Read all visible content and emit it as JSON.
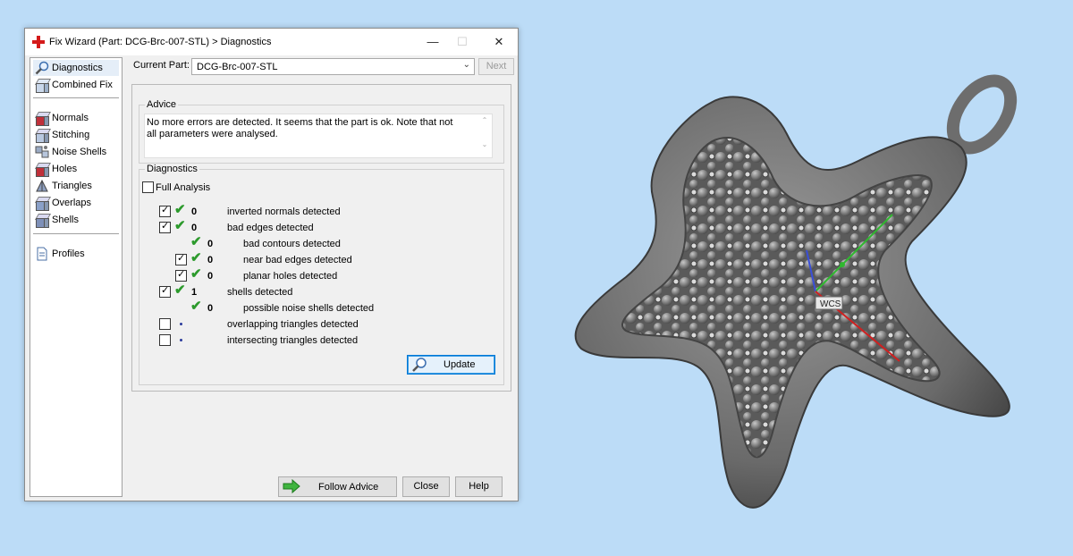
{
  "window": {
    "title": "Fix Wizard (Part: DCG-Brc-007-STL) > Diagnostics",
    "controls": {
      "minimize": "—",
      "maximize": "☐",
      "close": "✕"
    }
  },
  "nav": {
    "items": [
      {
        "label": "Diagnostics",
        "icon": "magnifier-icon",
        "selected": true
      },
      {
        "label": "Combined Fix",
        "icon": "cube-icon"
      },
      {
        "label": "Normals",
        "icon": "cube-red-icon"
      },
      {
        "label": "Stitching",
        "icon": "cube-stitch-icon"
      },
      {
        "label": "Noise Shells",
        "icon": "noise-shells-icon"
      },
      {
        "label": "Holes",
        "icon": "cube-holes-icon"
      },
      {
        "label": "Triangles",
        "icon": "triangles-icon"
      },
      {
        "label": "Overlaps",
        "icon": "cube-overlaps-icon"
      },
      {
        "label": "Shells",
        "icon": "cube-shells-icon"
      },
      {
        "label": "Profiles",
        "icon": "document-icon"
      }
    ]
  },
  "current_part": {
    "label": "Current Part:",
    "value": "DCG-Brc-007-STL"
  },
  "next_button": "Next",
  "advice": {
    "title": "Advice",
    "text": "No more errors are detected. It seems that the part is ok. Note that not all parameters were analysed."
  },
  "diagnostics": {
    "title": "Diagnostics",
    "full_analysis": {
      "label": "Full Analysis",
      "checked": false
    },
    "rows": [
      {
        "checkbox": true,
        "checked": true,
        "status": "ok",
        "count": "0",
        "label": "inverted normals detected",
        "indent": 0
      },
      {
        "checkbox": true,
        "checked": true,
        "status": "ok",
        "count": "0",
        "label": "bad edges detected",
        "indent": 0
      },
      {
        "checkbox": false,
        "checked": false,
        "status": "ok",
        "count": "0",
        "label": "bad contours detected",
        "indent": 1
      },
      {
        "checkbox": true,
        "checked": true,
        "status": "ok",
        "count": "0",
        "label": "near bad edges detected",
        "indent": 1
      },
      {
        "checkbox": true,
        "checked": true,
        "status": "ok",
        "count": "0",
        "label": "planar holes detected",
        "indent": 1
      },
      {
        "checkbox": true,
        "checked": true,
        "status": "ok",
        "count": "1",
        "label": "shells detected",
        "indent": 0
      },
      {
        "checkbox": false,
        "checked": false,
        "status": "ok",
        "count": "0",
        "label": "possible noise shells detected",
        "indent": 1
      },
      {
        "checkbox": true,
        "checked": false,
        "status": "none",
        "count": "",
        "label": "overlapping triangles detected",
        "indent": 0
      },
      {
        "checkbox": true,
        "checked": false,
        "status": "none",
        "count": "",
        "label": "intersecting triangles detected",
        "indent": 0
      }
    ],
    "update_button": "Update"
  },
  "footer": {
    "follow_advice": "Follow Advice",
    "close": "Close",
    "help": "Help"
  },
  "viewport": {
    "axis_label": "WCS",
    "colors": {
      "x_axis": "#d02020",
      "y_axis": "#2fb82f",
      "z_axis": "#3a4fd8",
      "model": "#6f6f6f"
    }
  }
}
